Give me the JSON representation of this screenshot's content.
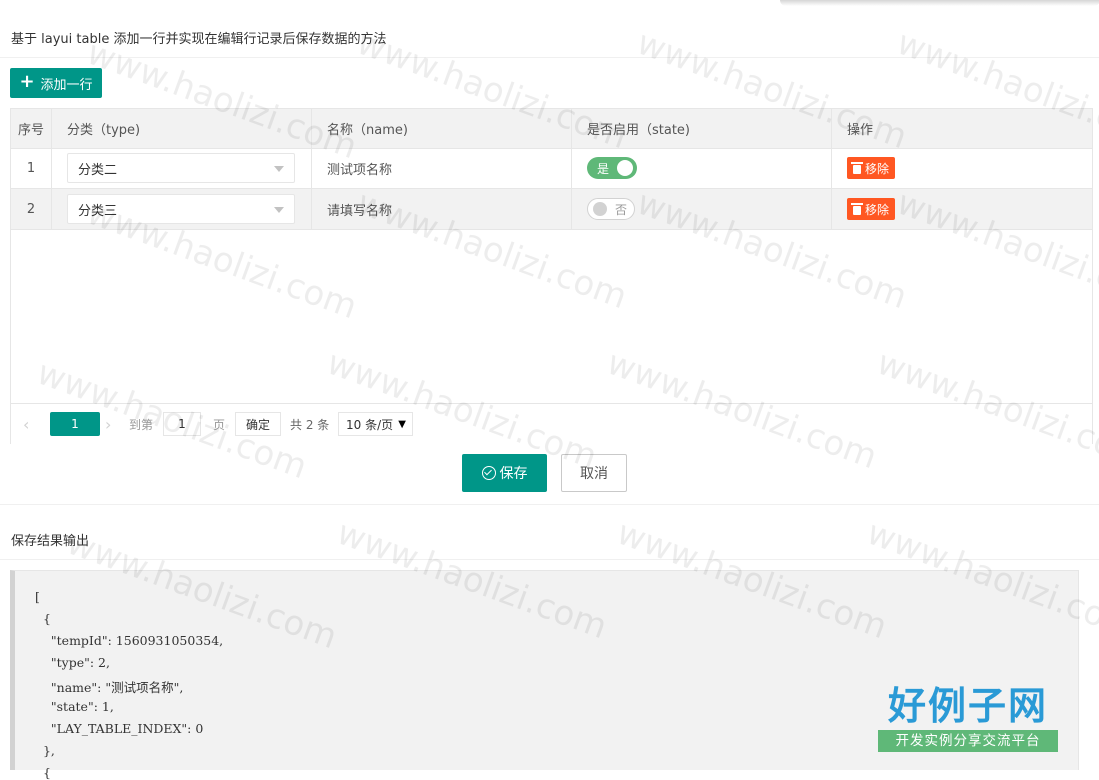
{
  "header": {
    "title": "基于 layui table 添加一行并实现在编辑行记录后保存数据的方法"
  },
  "toolbar": {
    "add_label": "添加一行"
  },
  "table": {
    "columns": [
      "序号",
      "分类（type)",
      "名称（name)",
      "是否启用（state)",
      "操作"
    ],
    "rows": [
      {
        "index": "1",
        "type": "分类二",
        "name": "测试项名称",
        "state": "是",
        "state_on": true,
        "action": "移除"
      },
      {
        "index": "2",
        "type": "分类三",
        "name": "请填写名称",
        "state": "否",
        "state_on": false,
        "action": "移除"
      }
    ]
  },
  "pager": {
    "prev": "‹",
    "current": "1",
    "next": "›",
    "goto_label": "到第",
    "goto_value": "1",
    "page_unit": "页",
    "confirm": "确定",
    "total": "共 2 条",
    "limit": "10 条/页"
  },
  "actions": {
    "save": "保存",
    "cancel": "取消"
  },
  "output": {
    "title": "保存结果输出",
    "lines": [
      "[",
      "  {",
      "    \"tempId\": 1560931050354,",
      "    \"type\": 2,",
      "    \"name\": \"测试项名称\",",
      "    \"state\": 1,",
      "    \"LAY_TABLE_INDEX\": 0",
      "  },",
      "  {"
    ]
  },
  "watermark": "www.haolizi.com",
  "logo": {
    "main": "好例子网",
    "sub": "开发实例分享交流平台"
  },
  "colors": {
    "primary": "#009688",
    "danger": "#ff5722",
    "switch_on": "#5fb878",
    "logo_blue": "#2a9ad6"
  }
}
